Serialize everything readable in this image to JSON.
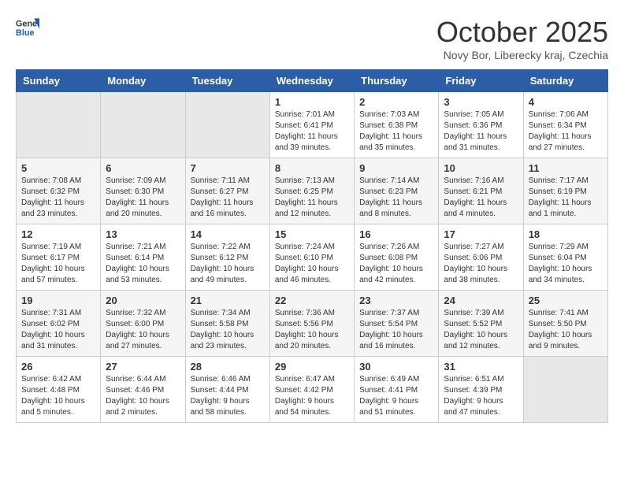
{
  "header": {
    "logo_line1": "General",
    "logo_line2": "Blue",
    "month": "October 2025",
    "location": "Novy Bor, Liberecky kraj, Czechia"
  },
  "days_of_week": [
    "Sunday",
    "Monday",
    "Tuesday",
    "Wednesday",
    "Thursday",
    "Friday",
    "Saturday"
  ],
  "weeks": [
    [
      {
        "day": "",
        "info": ""
      },
      {
        "day": "",
        "info": ""
      },
      {
        "day": "",
        "info": ""
      },
      {
        "day": "1",
        "info": "Sunrise: 7:01 AM\nSunset: 6:41 PM\nDaylight: 11 hours\nand 39 minutes."
      },
      {
        "day": "2",
        "info": "Sunrise: 7:03 AM\nSunset: 6:38 PM\nDaylight: 11 hours\nand 35 minutes."
      },
      {
        "day": "3",
        "info": "Sunrise: 7:05 AM\nSunset: 6:36 PM\nDaylight: 11 hours\nand 31 minutes."
      },
      {
        "day": "4",
        "info": "Sunrise: 7:06 AM\nSunset: 6:34 PM\nDaylight: 11 hours\nand 27 minutes."
      }
    ],
    [
      {
        "day": "5",
        "info": "Sunrise: 7:08 AM\nSunset: 6:32 PM\nDaylight: 11 hours\nand 23 minutes."
      },
      {
        "day": "6",
        "info": "Sunrise: 7:09 AM\nSunset: 6:30 PM\nDaylight: 11 hours\nand 20 minutes."
      },
      {
        "day": "7",
        "info": "Sunrise: 7:11 AM\nSunset: 6:27 PM\nDaylight: 11 hours\nand 16 minutes."
      },
      {
        "day": "8",
        "info": "Sunrise: 7:13 AM\nSunset: 6:25 PM\nDaylight: 11 hours\nand 12 minutes."
      },
      {
        "day": "9",
        "info": "Sunrise: 7:14 AM\nSunset: 6:23 PM\nDaylight: 11 hours\nand 8 minutes."
      },
      {
        "day": "10",
        "info": "Sunrise: 7:16 AM\nSunset: 6:21 PM\nDaylight: 11 hours\nand 4 minutes."
      },
      {
        "day": "11",
        "info": "Sunrise: 7:17 AM\nSunset: 6:19 PM\nDaylight: 11 hours\nand 1 minute."
      }
    ],
    [
      {
        "day": "12",
        "info": "Sunrise: 7:19 AM\nSunset: 6:17 PM\nDaylight: 10 hours\nand 57 minutes."
      },
      {
        "day": "13",
        "info": "Sunrise: 7:21 AM\nSunset: 6:14 PM\nDaylight: 10 hours\nand 53 minutes."
      },
      {
        "day": "14",
        "info": "Sunrise: 7:22 AM\nSunset: 6:12 PM\nDaylight: 10 hours\nand 49 minutes."
      },
      {
        "day": "15",
        "info": "Sunrise: 7:24 AM\nSunset: 6:10 PM\nDaylight: 10 hours\nand 46 minutes."
      },
      {
        "day": "16",
        "info": "Sunrise: 7:26 AM\nSunset: 6:08 PM\nDaylight: 10 hours\nand 42 minutes."
      },
      {
        "day": "17",
        "info": "Sunrise: 7:27 AM\nSunset: 6:06 PM\nDaylight: 10 hours\nand 38 minutes."
      },
      {
        "day": "18",
        "info": "Sunrise: 7:29 AM\nSunset: 6:04 PM\nDaylight: 10 hours\nand 34 minutes."
      }
    ],
    [
      {
        "day": "19",
        "info": "Sunrise: 7:31 AM\nSunset: 6:02 PM\nDaylight: 10 hours\nand 31 minutes."
      },
      {
        "day": "20",
        "info": "Sunrise: 7:32 AM\nSunset: 6:00 PM\nDaylight: 10 hours\nand 27 minutes."
      },
      {
        "day": "21",
        "info": "Sunrise: 7:34 AM\nSunset: 5:58 PM\nDaylight: 10 hours\nand 23 minutes."
      },
      {
        "day": "22",
        "info": "Sunrise: 7:36 AM\nSunset: 5:56 PM\nDaylight: 10 hours\nand 20 minutes."
      },
      {
        "day": "23",
        "info": "Sunrise: 7:37 AM\nSunset: 5:54 PM\nDaylight: 10 hours\nand 16 minutes."
      },
      {
        "day": "24",
        "info": "Sunrise: 7:39 AM\nSunset: 5:52 PM\nDaylight: 10 hours\nand 12 minutes."
      },
      {
        "day": "25",
        "info": "Sunrise: 7:41 AM\nSunset: 5:50 PM\nDaylight: 10 hours\nand 9 minutes."
      }
    ],
    [
      {
        "day": "26",
        "info": "Sunrise: 6:42 AM\nSunset: 4:48 PM\nDaylight: 10 hours\nand 5 minutes."
      },
      {
        "day": "27",
        "info": "Sunrise: 6:44 AM\nSunset: 4:46 PM\nDaylight: 10 hours\nand 2 minutes."
      },
      {
        "day": "28",
        "info": "Sunrise: 6:46 AM\nSunset: 4:44 PM\nDaylight: 9 hours\nand 58 minutes."
      },
      {
        "day": "29",
        "info": "Sunrise: 6:47 AM\nSunset: 4:42 PM\nDaylight: 9 hours\nand 54 minutes."
      },
      {
        "day": "30",
        "info": "Sunrise: 6:49 AM\nSunset: 4:41 PM\nDaylight: 9 hours\nand 51 minutes."
      },
      {
        "day": "31",
        "info": "Sunrise: 6:51 AM\nSunset: 4:39 PM\nDaylight: 9 hours\nand 47 minutes."
      },
      {
        "day": "",
        "info": ""
      }
    ]
  ]
}
